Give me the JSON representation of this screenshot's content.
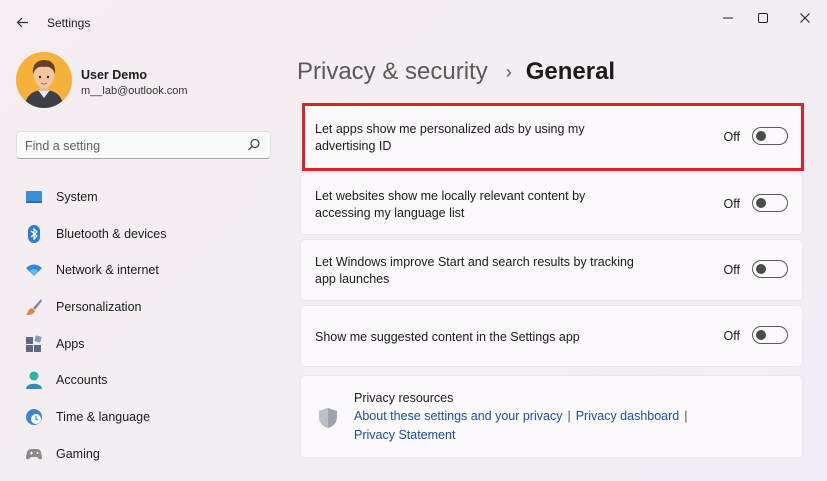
{
  "window": {
    "title": "Settings",
    "back_icon": "back-arrow-icon",
    "minimize_icon": "minimize-icon",
    "maximize_icon": "maximize-icon",
    "close_icon": "close-icon"
  },
  "profile": {
    "name": "User Demo",
    "email": "m__lab@outlook.com"
  },
  "search": {
    "placeholder": "Find a setting",
    "icon": "search-icon"
  },
  "nav": [
    {
      "label": "System",
      "icon": "system-icon",
      "color": "#3b8fd9"
    },
    {
      "label": "Bluetooth & devices",
      "icon": "bluetooth-icon",
      "color": "#2f7bd4"
    },
    {
      "label": "Network & internet",
      "icon": "wifi-icon",
      "color": "#2b8be0"
    },
    {
      "label": "Personalization",
      "icon": "brush-icon",
      "color": "#e1833a"
    },
    {
      "label": "Apps",
      "icon": "apps-icon",
      "color": "#5d6a85"
    },
    {
      "label": "Accounts",
      "icon": "accounts-icon",
      "color": "#2fb39a"
    },
    {
      "label": "Time & language",
      "icon": "clock-globe-icon",
      "color": "#3a86d2"
    },
    {
      "label": "Gaming",
      "icon": "gamepad-icon",
      "color": "#8a8a8a"
    }
  ],
  "breadcrumb": {
    "parent": "Privacy & security",
    "separator": "›",
    "current": "General"
  },
  "settings": [
    {
      "text": "Let apps show me personalized ads by using my advertising ID",
      "state": "Off",
      "on": false,
      "highlighted": true
    },
    {
      "text": "Let websites show me locally relevant content by accessing my language list",
      "state": "Off",
      "on": false,
      "highlighted": false
    },
    {
      "text": "Let Windows improve Start and search results by tracking app launches",
      "state": "Off",
      "on": false,
      "highlighted": false
    },
    {
      "text": "Show me suggested content in the Settings app",
      "state": "Off",
      "on": false,
      "highlighted": false
    }
  ],
  "resources": {
    "title": "Privacy resources",
    "icon": "shield-icon",
    "link1": "About these settings and your privacy",
    "separator": "|",
    "link2": "Privacy dashboard",
    "link3": "Privacy Statement"
  },
  "colors": {
    "highlight_border": "#d5242c",
    "link": "#1e4fa3"
  }
}
